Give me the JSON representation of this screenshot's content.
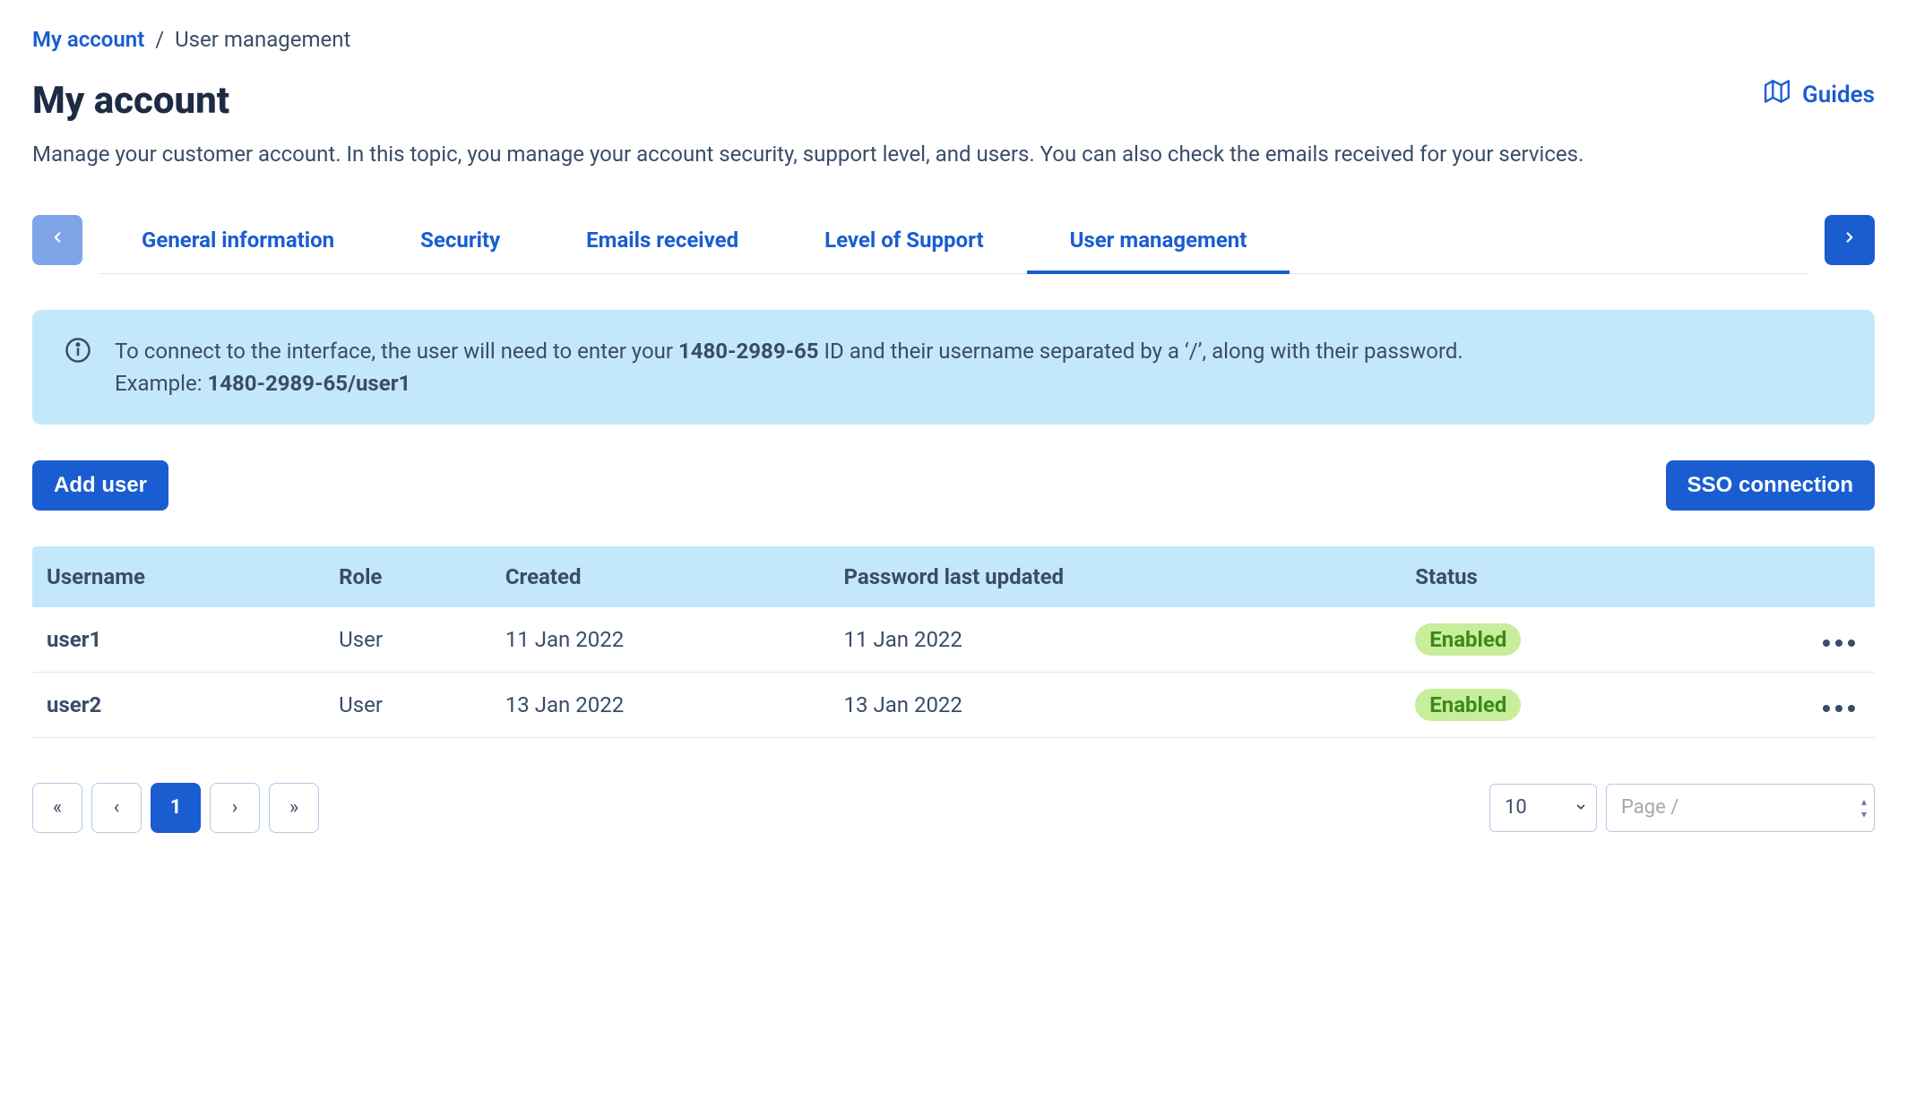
{
  "breadcrumb": {
    "root": "My account",
    "current": "User management"
  },
  "header": {
    "title": "My account",
    "guides_label": "Guides",
    "description": "Manage your customer account. In this topic, you manage your account security, support level, and users. You can also check the emails received for your services."
  },
  "tabs": [
    {
      "label": "General information",
      "active": false
    },
    {
      "label": "Security",
      "active": false
    },
    {
      "label": "Emails received",
      "active": false
    },
    {
      "label": "Level of Support",
      "active": false
    },
    {
      "label": "User management",
      "active": true
    }
  ],
  "info": {
    "text_pre": "To connect to the interface, the user will need to enter your ",
    "account_id": "1480-2989-65",
    "text_post": " ID and their username separated by a ‘/’, along with their password.",
    "example_label": "Example: ",
    "example_value": "1480-2989-65/user1"
  },
  "actions": {
    "add_user": "Add user",
    "sso": "SSO connection"
  },
  "table": {
    "columns": [
      "Username",
      "Role",
      "Created",
      "Password last updated",
      "Status",
      ""
    ],
    "rows": [
      {
        "username": "user1",
        "role": "User",
        "created": "11 Jan 2022",
        "pw_updated": "11 Jan 2022",
        "status": "Enabled"
      },
      {
        "username": "user2",
        "role": "User",
        "created": "13 Jan 2022",
        "pw_updated": "13 Jan 2022",
        "status": "Enabled"
      }
    ]
  },
  "pagination": {
    "first": "«",
    "prev": "‹",
    "current": "1",
    "next": "›",
    "last": "»",
    "page_size": "10",
    "page_input_placeholder": "Page /"
  }
}
